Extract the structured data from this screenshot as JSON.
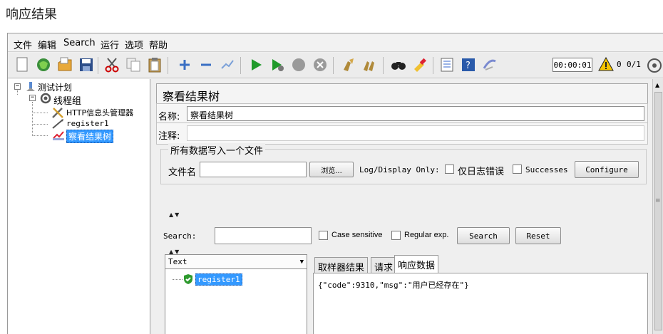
{
  "page": {
    "heading": "响应结果"
  },
  "menu": {
    "items": [
      "文件",
      "编辑",
      "Search",
      "运行",
      "选项",
      "帮助"
    ]
  },
  "toolbar": {
    "icons": [
      "new-icon",
      "templates-icon",
      "open-icon",
      "save-icon",
      "cut-icon",
      "copy-icon",
      "paste-icon",
      "expand-icon",
      "collapse-icon",
      "toggle-icon",
      "start-icon",
      "start-no-pause-icon",
      "stop-icon",
      "shutdown-icon",
      "clear-icon",
      "clear-all-icon",
      "search-icon",
      "reset-search-icon",
      "function-helper-icon",
      "help-icon",
      "remote-icon"
    ],
    "timer": "00:00:01",
    "warning_count": "0",
    "thread_count": "0/1"
  },
  "tree": {
    "items": [
      {
        "label": "测试计划",
        "icon": "test-plan-icon"
      },
      {
        "label": "线程组",
        "icon": "thread-group-icon"
      },
      {
        "label": "HTTP信息头管理器",
        "icon": "header-manager-icon"
      },
      {
        "label": "register1",
        "icon": "http-sampler-icon"
      },
      {
        "label": "察看结果树",
        "icon": "listener-icon",
        "selected": true
      }
    ]
  },
  "panel": {
    "title": "察看结果树",
    "name_label": "名称:",
    "name_value": "察看结果树",
    "comment_label": "注释:",
    "comment_value": "",
    "file_group_title": "所有数据写入一个文件",
    "filename_label": "文件名",
    "filename_value": "",
    "browse_label": "浏览...",
    "log_display_label": "Log/Display Only:",
    "errors_label": "仅日志错误",
    "successes_label": "Successes",
    "configure_label": "Configure"
  },
  "search": {
    "label": "Search:",
    "value": "",
    "case_sensitive_label": "Case sensitive",
    "regex_label": "Regular exp.",
    "search_button": "Search",
    "reset_button": "Reset"
  },
  "results": {
    "renderer": "Text",
    "samples": [
      {
        "label": "register1",
        "status": "success"
      }
    ],
    "tabs": [
      "取样器结果",
      "请求",
      "响应数据"
    ],
    "active_tab": "响应数据",
    "response_body": "{\"code\":9310,\"msg\":\"用户已经存在\"}"
  },
  "colors": {
    "selection": "#3399ff",
    "success": "#2e9a2e",
    "window_bg": "#efefef"
  }
}
